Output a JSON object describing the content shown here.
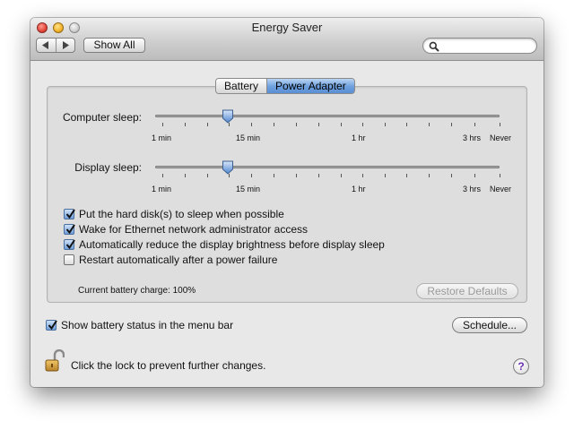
{
  "window": {
    "title": "Energy Saver",
    "back_icon": "triangle-left-icon",
    "forward_icon": "triangle-right-icon",
    "show_all_label": "Show All",
    "search_placeholder": "",
    "search_value": ""
  },
  "tabs": [
    {
      "label": "Battery",
      "active": false
    },
    {
      "label": "Power Adapter",
      "active": true
    }
  ],
  "sliders": {
    "tick_labels": [
      "1 min",
      "15 min",
      "1 hr",
      "3 hrs",
      "Never"
    ],
    "computer_sleep": {
      "label": "Computer sleep:",
      "value": "15 min"
    },
    "display_sleep": {
      "label": "Display sleep:",
      "value": "15 min"
    }
  },
  "options": [
    {
      "label": "Put the hard disk(s) to sleep when possible",
      "checked": true
    },
    {
      "label": "Wake for Ethernet network administrator access",
      "checked": true
    },
    {
      "label": "Automatically reduce the display brightness before display sleep",
      "checked": true
    },
    {
      "label": "Restart automatically after a power failure",
      "checked": false
    }
  ],
  "battery_charge": "Current battery charge: 100%",
  "restore_defaults_label": "Restore Defaults",
  "show_battery_status": {
    "label": "Show battery status in the menu bar",
    "checked": true
  },
  "schedule_label": "Schedule...",
  "lock_text": "Click the lock to prevent further changes.",
  "help_label": "?",
  "colors": {
    "accent": "#6c9fdd",
    "help_glyph": "#6b2fb0"
  }
}
